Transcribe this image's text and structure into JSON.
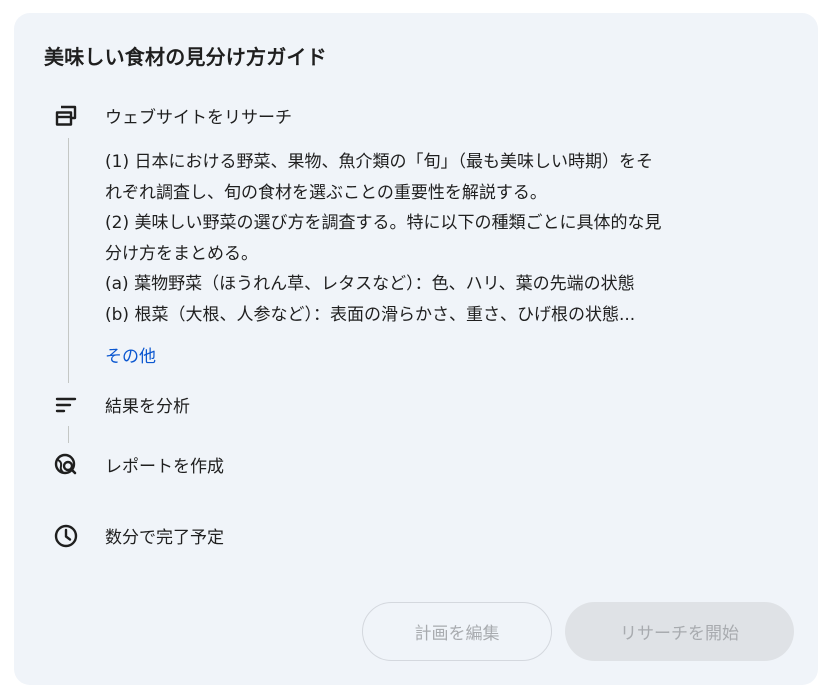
{
  "card": {
    "title": "美味しい食材の見分け方ガイド"
  },
  "steps": [
    {
      "icon": "browser-windows-icon",
      "label": "ウェブサイトをリサーチ"
    },
    {
      "icon": "analysis-lines-icon",
      "label": "結果を分析"
    },
    {
      "icon": "globe-search-icon",
      "label": "レポートを作成"
    },
    {
      "icon": "clock-icon",
      "label": "数分で完了予定"
    }
  ],
  "research_plan": {
    "lines": [
      "(1) 日本における野菜、果物、魚介類の「旬」（最も美味しい時期）をそ",
      "れぞれ調査し、旬の食材を選ぶことの重要性を解説する。",
      "(2) 美味しい野菜の選び方を調査する。特に以下の種類ごとに具体的な見",
      "分け方をまとめる。",
      "(a) 葉物野菜（ほうれん草、レタスなど）：色、ハリ、葉の先端の状態",
      "(b) 根菜（大根、人参など）：表面の滑らかさ、重さ、ひげ根の状態..."
    ],
    "more_label": "その他"
  },
  "buttons": {
    "edit_plan": "計画を編集",
    "start_research": "リサーチを開始"
  },
  "colors": {
    "card_background": "#f0f4f9",
    "link": "#0b57d0",
    "disabled_text": "#a8abaf",
    "disabled_button": "#dfe2e6"
  }
}
